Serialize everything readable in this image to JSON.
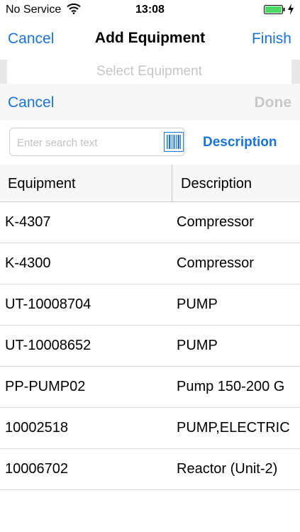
{
  "status_bar": {
    "carrier": "No Service",
    "time": "13:08"
  },
  "nav": {
    "left_label": "Cancel",
    "title": "Add Equipment",
    "right_label": "Finish"
  },
  "selector": {
    "placeholder": "Select Equipment"
  },
  "sub_bar": {
    "cancel_label": "Cancel",
    "done_label": "Done"
  },
  "search": {
    "placeholder": "Enter search text",
    "value": "",
    "toggle_label": "Description"
  },
  "table": {
    "columns": [
      "Equipment",
      "Description"
    ],
    "rows": [
      {
        "equipment": "K-4307",
        "description": "Compressor"
      },
      {
        "equipment": "K-4300",
        "description": "Compressor"
      },
      {
        "equipment": "UT-10008704",
        "description": "PUMP"
      },
      {
        "equipment": "UT-10008652",
        "description": "PUMP"
      },
      {
        "equipment": "PP-PUMP02",
        "description": "Pump 150-200 G"
      },
      {
        "equipment": "10002518",
        "description": "PUMP,ELECTRIC"
      },
      {
        "equipment": "10006702",
        "description": "Reactor (Unit-2)"
      }
    ]
  },
  "colors": {
    "accent": "#1a73d9",
    "battery": "#4cd964",
    "disabled": "#c8c8c8"
  },
  "icons": {
    "wifi": "wifi-icon",
    "battery": "battery-icon",
    "charging": "charging-bolt-icon",
    "barcode": "barcode-icon"
  }
}
